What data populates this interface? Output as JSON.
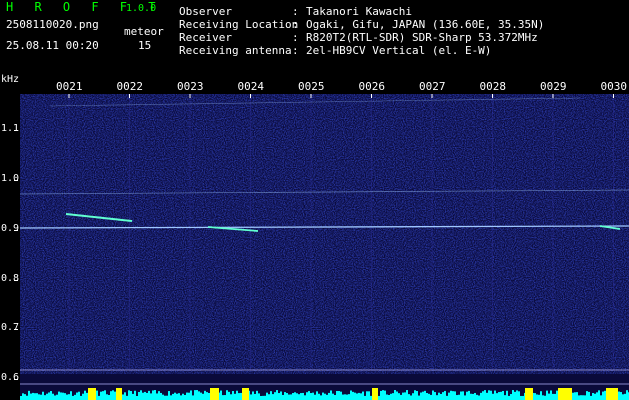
{
  "header": {
    "app_title": "H R O F F T",
    "app_version": "1.0.0",
    "filename": "2508110020.png",
    "meteor_label": "meteor",
    "datetime": "25.08.11 00:20",
    "meteor_count": "15",
    "info": {
      "labels": "Observer\nReceiving Location\nReceiver\nReceiving antenna",
      "separators": ":\n:\n:\n:",
      "values": "Takanori Kawachi\nOgaki, Gifu, JAPAN (136.60E, 35.35N)\nR820T2(RTL-SDR) SDR-Sharp 53.372MHz\n2el-HB9CV Vertical (el. E-W)"
    }
  },
  "axis": {
    "y_unit": "kHz",
    "y_ticks": [
      "1.1",
      "1.0",
      "0.9",
      "0.8",
      "0.7",
      "0.6"
    ],
    "time_ticks": [
      "0021",
      "0022",
      "0023",
      "0024",
      "0025",
      "0026",
      "0027",
      "0028",
      "0029",
      "0030"
    ]
  },
  "colors": {
    "title": "#00ff00",
    "background": "#0a0a3a",
    "signal": "#a0c8ff",
    "meteor": "#60ffd0",
    "power_bar": "#00ffff",
    "power_peak": "#ffff00"
  }
}
